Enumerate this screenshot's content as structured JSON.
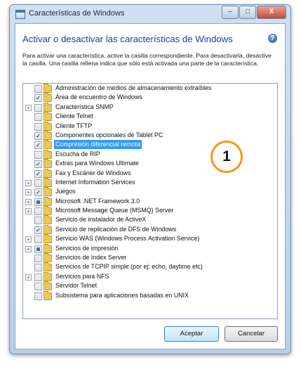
{
  "window": {
    "title": "Características de Windows",
    "controls": {
      "minimize": "–",
      "maximize": "□",
      "close": "X"
    }
  },
  "heading": "Activar o desactivar las características de Windows",
  "description": "Para activar una característica, active la casilla correspondiente. Para desactivarla, desactive la casilla. Una casilla rellena indica que sólo está activada una parte de la característica.",
  "features": [
    {
      "label": "Administración de medios de almacenamiento extraíbles",
      "state": "unchecked",
      "expandable": false
    },
    {
      "label": "Área de encuentro de Windows",
      "state": "checked",
      "expandable": false
    },
    {
      "label": "Característica SNMP",
      "state": "unchecked",
      "expandable": true
    },
    {
      "label": "Cliente Telnet",
      "state": "unchecked",
      "expandable": false
    },
    {
      "label": "Cliente TFTP",
      "state": "unchecked",
      "expandable": false
    },
    {
      "label": "Componentes opcionales de Tablet PC",
      "state": "checked",
      "expandable": false
    },
    {
      "label": "Compresión diferencial remota",
      "state": "checked",
      "expandable": false,
      "selected": true
    },
    {
      "label": "Escucha de RIP",
      "state": "unchecked",
      "expandable": false
    },
    {
      "label": "Extras para Windows Ultimate",
      "state": "checked",
      "expandable": false
    },
    {
      "label": "Fax y Escáner de Windows",
      "state": "checked",
      "expandable": false
    },
    {
      "label": "Internet Information Services",
      "state": "unchecked",
      "expandable": true
    },
    {
      "label": "Juegos",
      "state": "checked",
      "expandable": true
    },
    {
      "label": "Microsoft .NET Framework 3.0",
      "state": "partial",
      "expandable": true
    },
    {
      "label": "Microsoft Message Queue (MSMQ) Server",
      "state": "unchecked",
      "expandable": true
    },
    {
      "label": "Servicio de instalador de ActiveX",
      "state": "unchecked",
      "expandable": false
    },
    {
      "label": "Servicio de replicación de DFS de Windows",
      "state": "checked",
      "expandable": false
    },
    {
      "label": "Servicio WAS (Windows Process Activation Service)",
      "state": "unchecked",
      "expandable": true
    },
    {
      "label": "Servicios de impresión",
      "state": "partial",
      "expandable": true
    },
    {
      "label": "Servicios de Index Server",
      "state": "unchecked",
      "expandable": false
    },
    {
      "label": "Servicios de TCPIP simple (por ej: echo, daytime etc)",
      "state": "unchecked",
      "expandable": false
    },
    {
      "label": "Servicios para NFS",
      "state": "unchecked",
      "expandable": true
    },
    {
      "label": "Servidor Telnet",
      "state": "unchecked",
      "expandable": false
    },
    {
      "label": "Subsistema para aplicaciones basadas en UNIX",
      "state": "unchecked",
      "expandable": false
    }
  ],
  "buttons": {
    "ok": "Aceptar",
    "cancel": "Cancelar"
  },
  "callout": {
    "number": "1",
    "color": "#f29b1d"
  },
  "colors": {
    "selection": "#3399ff",
    "heading": "#1d3f8f"
  },
  "icons": {
    "expand": "+",
    "check": "✓"
  }
}
